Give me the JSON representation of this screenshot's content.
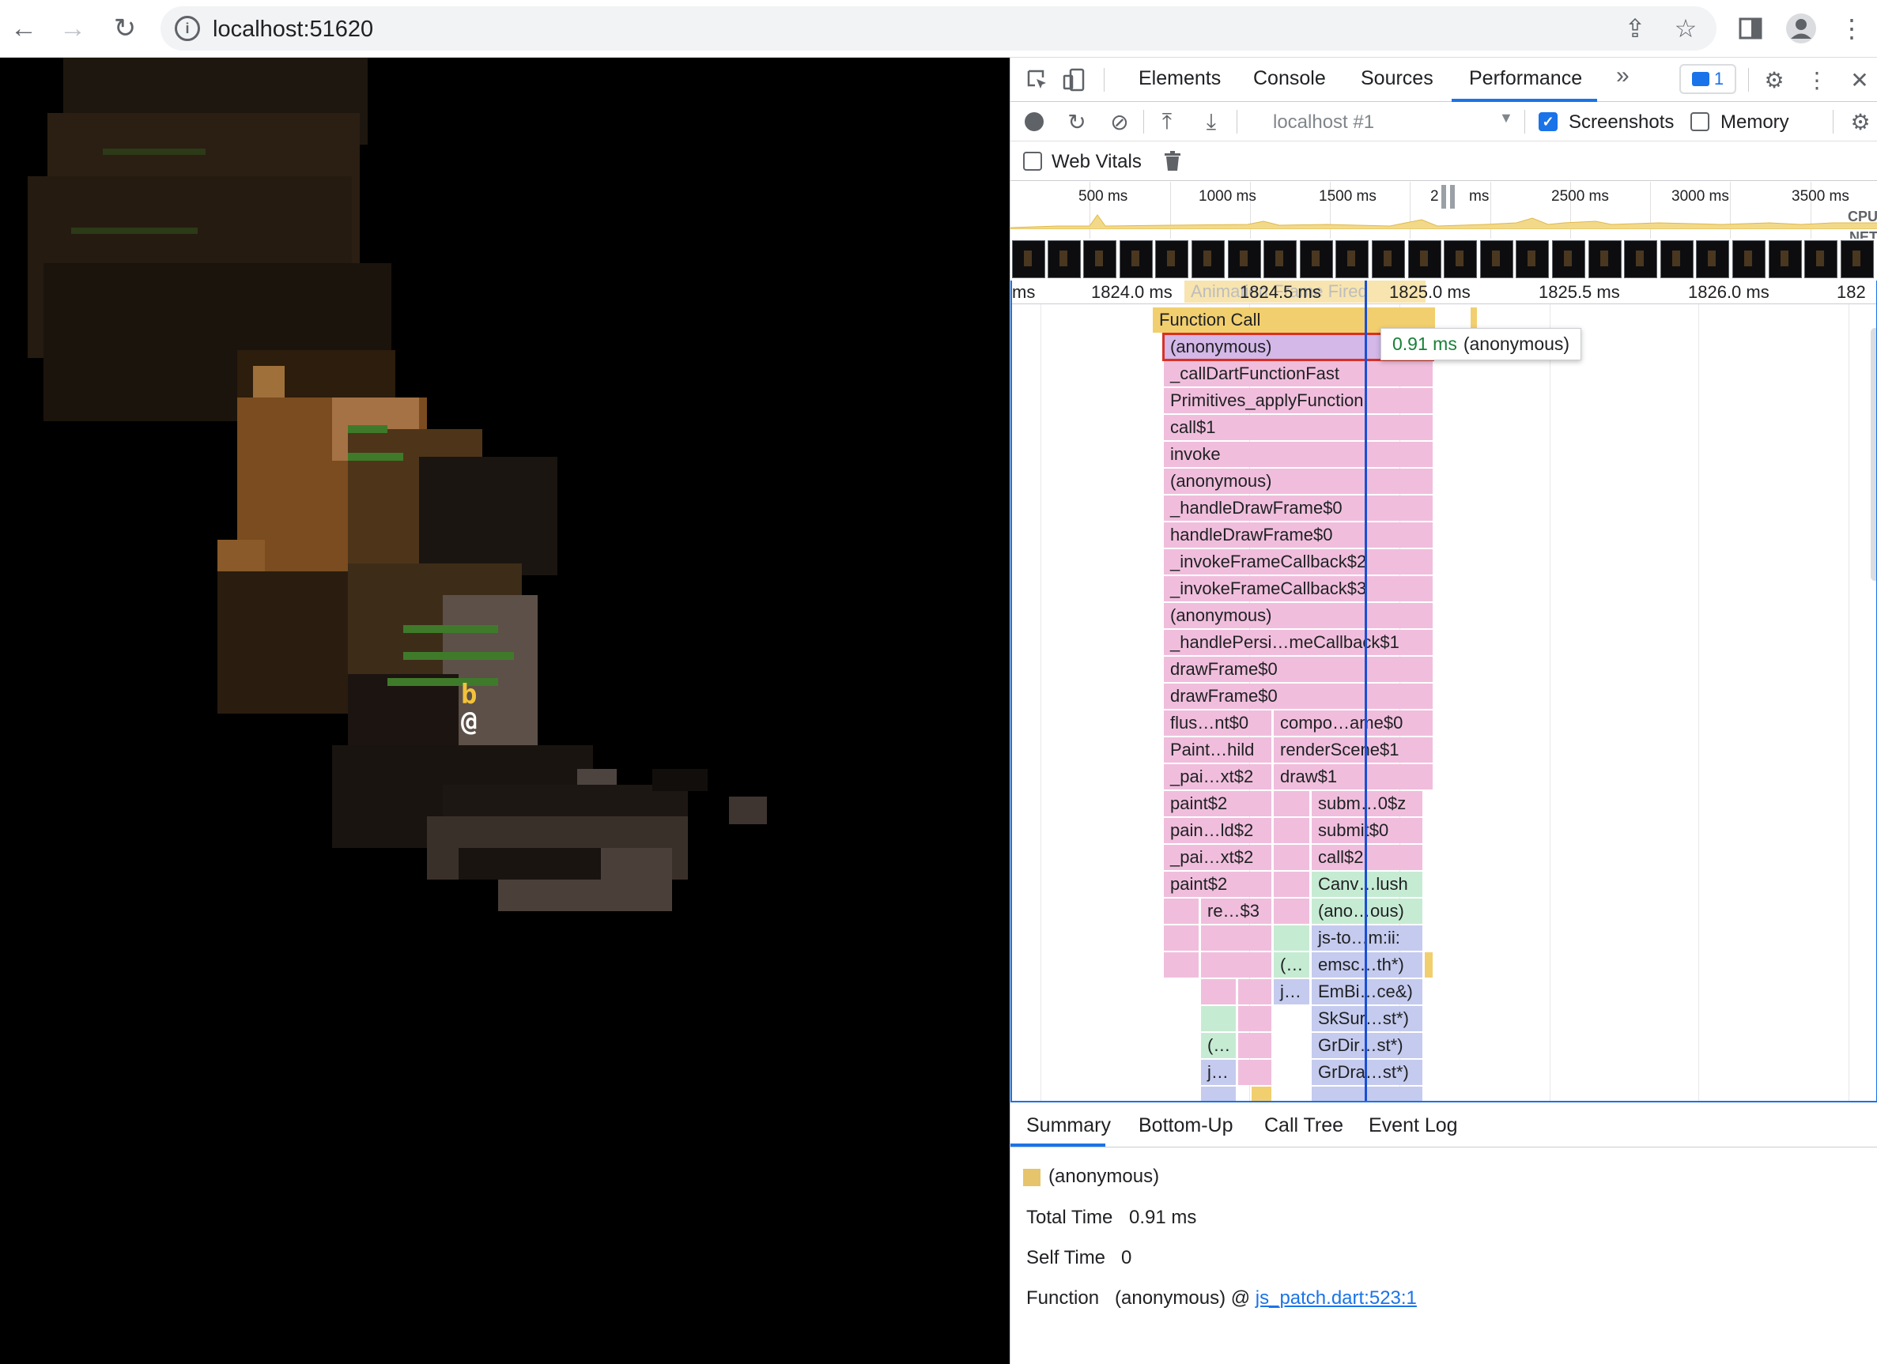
{
  "browser": {
    "url": "localhost:51620"
  },
  "devtools": {
    "tabs": [
      "Elements",
      "Console",
      "Sources",
      "Performance"
    ],
    "active_tab": "Performance",
    "more_tabs": "»",
    "issues_count": "1",
    "toolbar": {
      "recording_select": "localhost #1",
      "screenshots_label": "Screenshots",
      "screenshots_checked": true,
      "memory_label": "Memory",
      "memory_checked": false,
      "web_vitals_label": "Web Vitals",
      "web_vitals_checked": false
    },
    "overview": {
      "ticks": [
        "500 ms",
        "1000 ms",
        "1500 ms",
        "2",
        "ms",
        "2500 ms",
        "3000 ms",
        "3500 ms"
      ],
      "cpu_label": "CPU",
      "net_label": "NET"
    },
    "flame": {
      "ruler_ticks": [
        "ms",
        "1824.0 ms",
        "1824.5 ms",
        "1825.0 ms",
        "1825.5 ms",
        "1826.0 ms",
        "182"
      ],
      "ruler_faded": "Animation Frame Fired",
      "rows": [
        [
          {
            "label": "Function Call",
            "color": "yellow"
          }
        ],
        [
          {
            "label": "(anonymous)",
            "color": "lav"
          }
        ],
        [
          {
            "label": "_callDartFunctionFast",
            "color": "pink"
          }
        ],
        [
          {
            "label": "Primitives_applyFunction",
            "color": "pink"
          }
        ],
        [
          {
            "label": "call$1",
            "color": "pink"
          }
        ],
        [
          {
            "label": "invoke",
            "color": "pink"
          }
        ],
        [
          {
            "label": "(anonymous)",
            "color": "pink"
          }
        ],
        [
          {
            "label": "_handleDrawFrame$0",
            "color": "pink"
          }
        ],
        [
          {
            "label": "handleDrawFrame$0",
            "color": "pink"
          }
        ],
        [
          {
            "label": "_invokeFrameCallback$2",
            "color": "pink"
          }
        ],
        [
          {
            "label": "_invokeFrameCallback$3",
            "color": "pink"
          }
        ],
        [
          {
            "label": "(anonymous)",
            "color": "pink"
          }
        ],
        [
          {
            "label": "_handlePersi…meCallback$1",
            "color": "pink"
          }
        ],
        [
          {
            "label": "drawFrame$0",
            "color": "pink"
          }
        ],
        [
          {
            "label": "drawFrame$0",
            "color": "pink"
          }
        ],
        [
          {
            "label": "flus…nt$0",
            "color": "pink"
          },
          {
            "label": "compo…ame$0",
            "color": "pink"
          }
        ],
        [
          {
            "label": "Paint…hild",
            "color": "pink"
          },
          {
            "label": "renderScene$1",
            "color": "pink"
          }
        ],
        [
          {
            "label": "_pai…xt$2",
            "color": "pink"
          },
          {
            "label": "draw$1",
            "color": "pink"
          }
        ],
        [
          {
            "label": "paint$2",
            "color": "pink"
          },
          {
            "label": "subm…0$z",
            "color": "pink"
          }
        ],
        [
          {
            "label": "pain…ld$2",
            "color": "pink"
          },
          {
            "label": "submit$0",
            "color": "pink"
          }
        ],
        [
          {
            "label": "_pai…xt$2",
            "color": "pink"
          },
          {
            "label": "call$2",
            "color": "pink"
          }
        ],
        [
          {
            "label": "paint$2",
            "color": "pink"
          },
          {
            "label": "Canv…lush",
            "color": "green"
          }
        ],
        [
          {
            "label": "re…$3",
            "color": "pink"
          },
          {
            "label": "(ano…ous)",
            "color": "green"
          }
        ],
        [
          {
            "label": "js-to…m:ii:",
            "color": "blue"
          }
        ],
        [
          {
            "label": "(…",
            "color": "green"
          },
          {
            "label": "emsc…th*)",
            "color": "blue"
          }
        ],
        [
          {
            "label": "j…",
            "color": "blue"
          },
          {
            "label": "EmBi…ce&)",
            "color": "blue"
          }
        ],
        [
          {
            "label": "SkSur…st*)",
            "color": "blue"
          }
        ],
        [
          {
            "label": "(…",
            "color": "green"
          },
          {
            "label": "GrDir…st*)",
            "color": "blue"
          }
        ],
        [
          {
            "label": "j…",
            "color": "blue"
          },
          {
            "label": "GrDra…st*)",
            "color": "blue"
          }
        ]
      ],
      "tooltip_time": "0.91 ms",
      "tooltip_name": "(anonymous)"
    },
    "details": {
      "tabs": [
        "Summary",
        "Bottom-Up",
        "Call Tree",
        "Event Log"
      ],
      "active_tab": "Summary",
      "title": "(anonymous)",
      "total_time_label": "Total Time",
      "total_time_value": "0.91 ms",
      "self_time_label": "Self Time",
      "self_time_value": "0",
      "function_label": "Function",
      "function_value": "(anonymous) @",
      "function_link": "js_patch.dart:523:1"
    }
  },
  "game": {
    "glyph_b": "b",
    "glyph_at": "@"
  },
  "colors": {
    "accent": "#1a73e8",
    "selection": "#d93025",
    "cursor": "#1a4fd6"
  }
}
